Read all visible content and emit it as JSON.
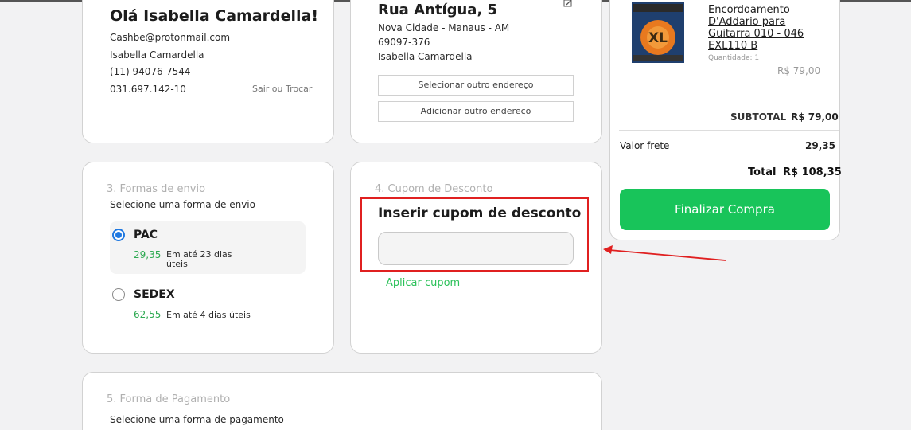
{
  "user": {
    "greeting": "Olá Isabella Camardella!",
    "email": "Cashbe@protonmail.com",
    "name": "Isabella Camardella",
    "phone": "(11) 94076-7544",
    "cpf": "031.697.142-10",
    "switch_label": "Sair ou Trocar"
  },
  "address": {
    "street": "Rua Antígua, 5",
    "city": "Nova Cidade - Manaus - AM",
    "zip": "69097-376",
    "recipient": "Isabella Camardella",
    "select_other": "Selecionar outro endereço",
    "add_other": "Adicionar outro endereço"
  },
  "shipping": {
    "title": "3.  Formas de envio",
    "subtitle": "Selecione uma forma de envio",
    "options": [
      {
        "name": "PAC",
        "price": "29,35",
        "eta_line1": "Em até 23 dias",
        "eta_line2": "úteis",
        "selected": true
      },
      {
        "name": "SEDEX",
        "price": "62,55",
        "eta_line1": "Em até 4 dias úteis",
        "eta_line2": "",
        "selected": false
      }
    ]
  },
  "coupon": {
    "title": "4.  Cupom de Desconto",
    "heading": "Inserir cupom de desconto",
    "input_value": "",
    "apply_label": "Aplicar cupom"
  },
  "payment": {
    "title": "5.  Forma de Pagamento",
    "subtitle": "Selecione uma forma de pagamento"
  },
  "summary": {
    "product": {
      "name_line1": "Encordoamento",
      "name_line2": "D'Addario para",
      "name_line3": "Guitarra 010 - 046",
      "name_line4": "EXL110 B",
      "quantity": "Quantidade: 1",
      "price": "R$ 79,00",
      "image_badge": "XL"
    },
    "subtotal_label": "SUBTOTAL",
    "subtotal_value": "R$ 79,00",
    "shipping_label": "Valor frete",
    "shipping_value": "29,35",
    "total_label": "Total",
    "total_value": "R$ 108,35",
    "finalize_label": "Finalizar Compra"
  },
  "colors": {
    "accent_green": "#18c45a",
    "price_green": "#2eaa52",
    "radio_blue": "#1f78e0",
    "annotation_red": "#e02020"
  }
}
